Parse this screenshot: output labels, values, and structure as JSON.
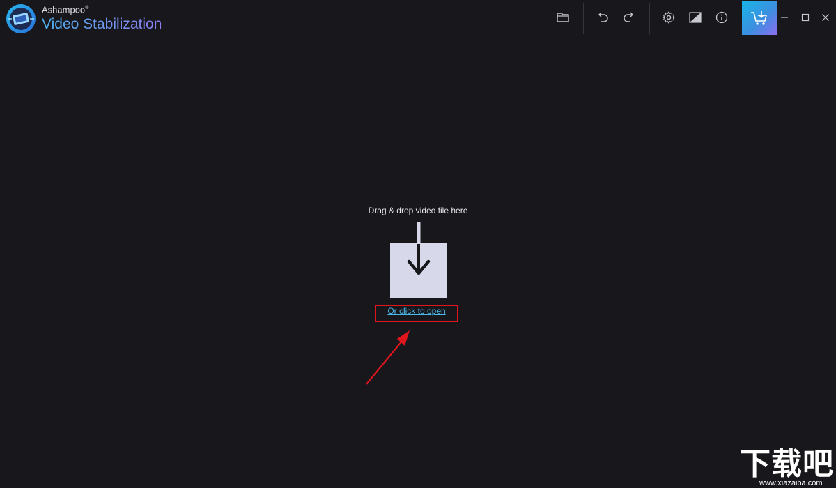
{
  "app": {
    "brand_small": "Ashampoo",
    "brand_reg": "®",
    "brand_title": "Video Stabilization"
  },
  "toolbar": {
    "icons": [
      "folder-open-icon",
      "undo-icon",
      "redo-icon",
      "settings-gear-icon",
      "theme-toggle-icon",
      "info-icon",
      "cart-icon"
    ],
    "cart_color": "#1ab4e8"
  },
  "window_controls": {
    "icons": [
      "minimize-icon",
      "maximize-icon",
      "close-icon"
    ]
  },
  "dropzone": {
    "title": "Drag & drop video file here",
    "link_text": "Or click to open",
    "box_color": "#d7d9ea",
    "link_color": "#4ab8e8"
  },
  "annotation": {
    "highlight_color": "#e0161c"
  },
  "watermark": {
    "text": "下载吧",
    "url": "www.xiazaiba.com"
  }
}
